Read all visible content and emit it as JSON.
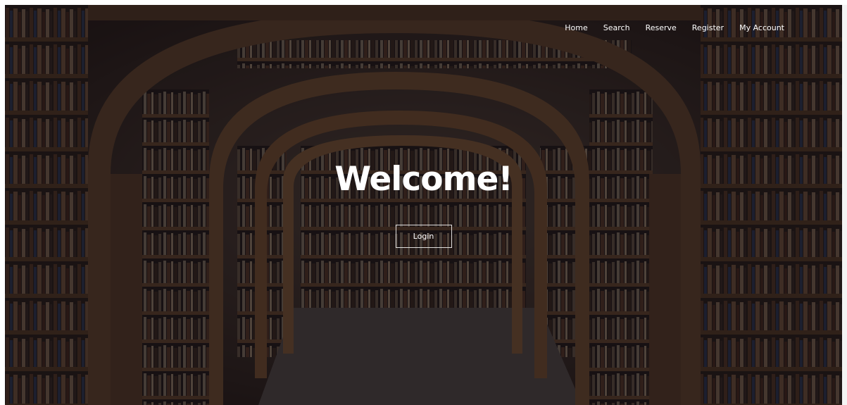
{
  "nav": {
    "items": [
      {
        "label": "Home"
      },
      {
        "label": "Search"
      },
      {
        "label": "Reserve"
      },
      {
        "label": "Register"
      },
      {
        "label": "My Account"
      }
    ]
  },
  "hero": {
    "title": "Welcome!",
    "login_label": "Login"
  },
  "colors": {
    "overlay": "#0c0a12",
    "text": "#ffffff",
    "wood": "#6b4a2b"
  },
  "background": {
    "icon": "library-arches-image"
  }
}
